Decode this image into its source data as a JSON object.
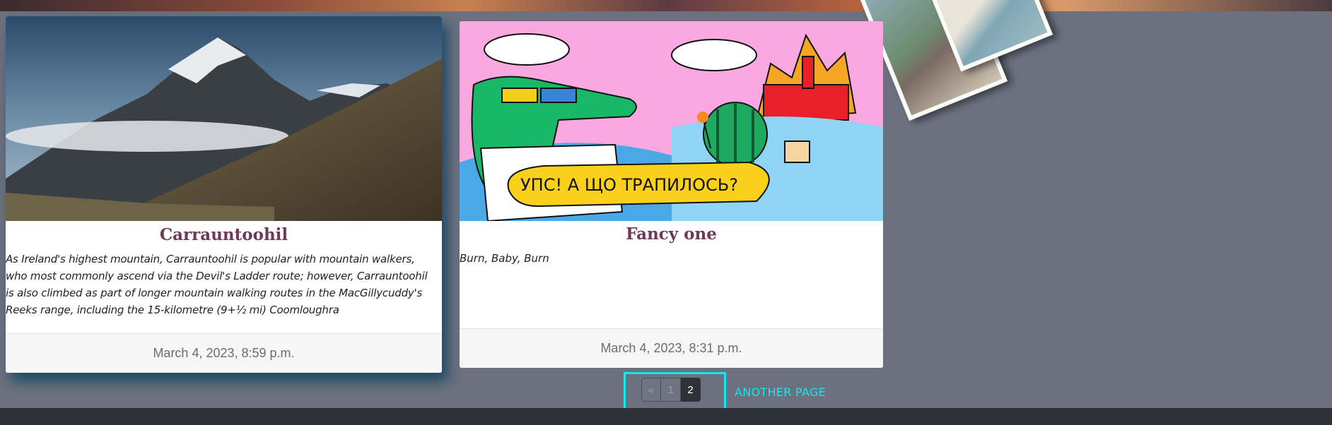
{
  "cards": [
    {
      "title": "Carrauntoohil",
      "text": "As Ireland's highest mountain, Carrauntoohil is popular with mountain walkers, who most commonly ascend via the Devil's Ladder route; however, Carrauntoohil is also climbed as part of longer mountain walking routes in the MacGillycuddy's Reeks range, including the 15-kilometre (9+½ mi) Coomloughra",
      "date": "March 4, 2023, 8:59 p.m.",
      "image": "mountain-photo"
    },
    {
      "title": "Fancy one",
      "text": "Burn, Baby, Burn",
      "date": "March 4, 2023, 8:31 p.m.",
      "image": "cartoon-illustration",
      "speech_bubble": "УПС! А ЩО ТРАПИЛОСЬ?"
    }
  ],
  "pagination": {
    "prev": "«",
    "pages": [
      "1",
      "2"
    ],
    "active": "2"
  },
  "another_page_label": "ANOTHER PAGE",
  "colors": {
    "background": "#6b717e",
    "title": "#6d3a55",
    "highlight": "#18e6ef",
    "footer_bar": "#2e3237"
  }
}
